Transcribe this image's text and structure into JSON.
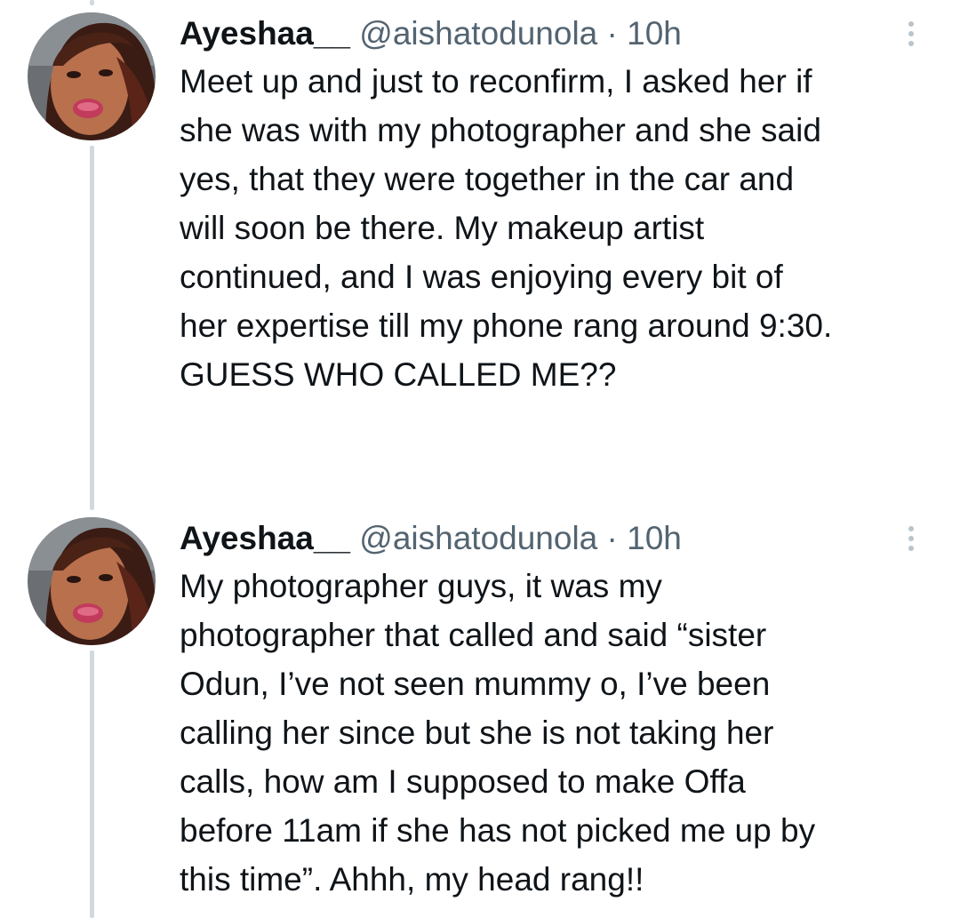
{
  "tweets": [
    {
      "display_name": "Ayeshaa__",
      "handle": "@aishatodunola",
      "separator": "·",
      "time": "10h",
      "avatar_icon": "profile-photo-avatar",
      "more_icon": "vertical-ellipsis-icon",
      "text": "Meet up and just to reconfirm, I asked her if\nshe was with my photographer and she said\nyes, that they were together in the car and\nwill soon be there. My makeup artist\ncontinued, and I was enjoying every bit of\nher expertise till my phone rang around 9:30.\nGUESS WHO CALLED ME??"
    },
    {
      "display_name": "Ayeshaa__",
      "handle": "@aishatodunola",
      "separator": "·",
      "time": "10h",
      "avatar_icon": "profile-photo-avatar",
      "more_icon": "vertical-ellipsis-icon",
      "text": "My photographer guys, it was my\nphotographer that called and said “sister\nOdun, I’ve not seen mummy o, I’ve been\ncalling her since but she is not taking her\ncalls, how am I supposed to make Offa\nbefore 11am if she has not picked me up by\nthis time”. Ahhh, my head rang!!"
    }
  ],
  "colors": {
    "text": "#0f1419",
    "secondary": "#536471",
    "thread_line": "#cfd9de",
    "more_dots": "#b9c4cc"
  }
}
